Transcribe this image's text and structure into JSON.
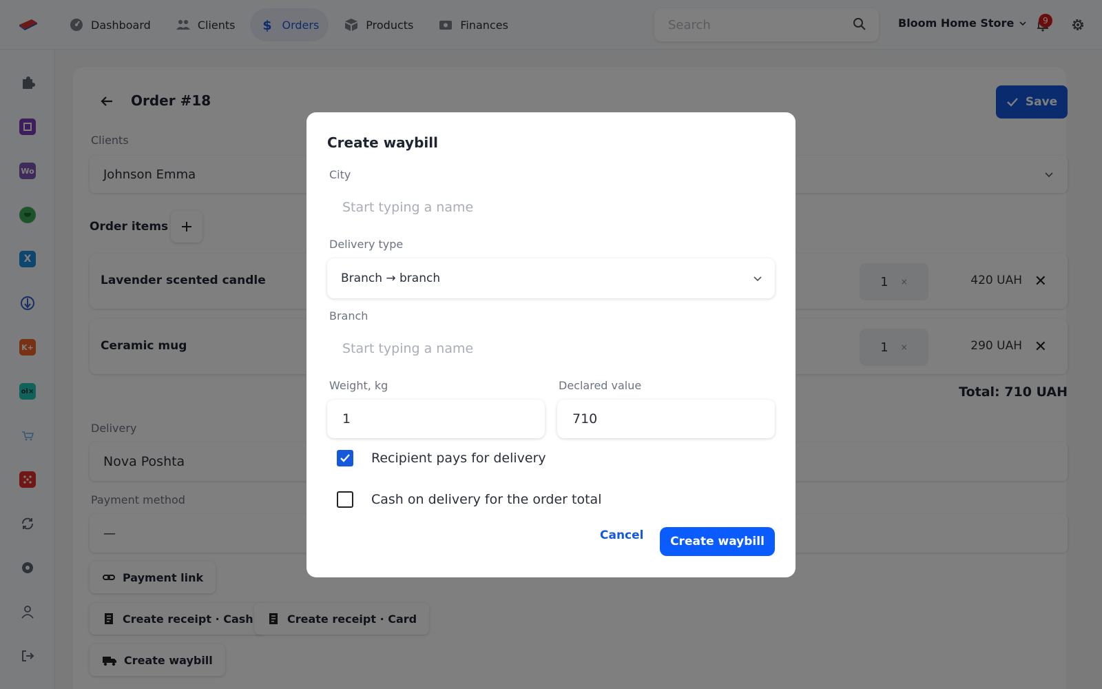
{
  "nav": {
    "items": [
      {
        "label": "Dashboard",
        "icon": "dashboard-icon",
        "active": false
      },
      {
        "label": "Clients",
        "icon": "users-icon",
        "active": false
      },
      {
        "label": "Orders",
        "icon": "dollar-icon",
        "active": true
      },
      {
        "label": "Products",
        "icon": "box-icon",
        "active": false
      },
      {
        "label": "Finances",
        "icon": "money-icon",
        "active": false
      }
    ],
    "search_placeholder": "Search",
    "store_name": "Bloom Home Store",
    "notification_count": "9"
  },
  "sidebar": {
    "icons": [
      "puzzle-icon",
      "square-app-icon",
      "woo-icon",
      "frog-app-icon",
      "x-app-icon",
      "arrow-circle-icon",
      "k-app-icon",
      "olx-icon",
      "cart-icon",
      "dice-app-icon",
      "sync-icon",
      "settings-icon",
      "user-icon",
      "logout-icon"
    ],
    "labels": {
      "woo": "Wo",
      "x": "X",
      "k": "K+",
      "olx": "ol×"
    }
  },
  "order": {
    "title": "Order #18",
    "save_label": "Save",
    "clients_label": "Clients",
    "client_value": "Johnson Emma",
    "items_label": "Order items",
    "items": [
      {
        "name": "Lavender scented candle",
        "qty": "1",
        "qty_sep": "×",
        "price": "420 UAH"
      },
      {
        "name": "Ceramic mug",
        "qty": "1",
        "qty_sep": "×",
        "price": "290 UAH"
      }
    ],
    "total": "Total: 710 UAH",
    "delivery_label": "Delivery",
    "delivery_value": "Nova Poshta",
    "payment_label": "Payment method",
    "payment_value": "—",
    "actions": {
      "payment_link": "Payment link",
      "receipt_cash": "Create receipt · Cash",
      "receipt_card": "Create receipt · Card",
      "waybill": "Create waybill"
    }
  },
  "modal": {
    "title": "Create waybill",
    "city_label": "City",
    "city_placeholder": "Start typing a name",
    "delivery_type_label": "Delivery type",
    "delivery_type_value": "Branch → branch",
    "branch_label": "Branch",
    "branch_placeholder": "Start typing a name",
    "weight_label": "Weight, kg",
    "weight_value": "1",
    "declared_label": "Declared value",
    "declared_value": "710",
    "recipient_pays_label": "Recipient pays for delivery",
    "recipient_pays_checked": true,
    "cod_label": "Cash on delivery for the order total",
    "cod_checked": false,
    "cancel_label": "Cancel",
    "submit_label": "Create waybill"
  },
  "colors": {
    "accent": "#1458dc",
    "primary_button": "#0b5cff",
    "badge": "#d81b1b"
  }
}
